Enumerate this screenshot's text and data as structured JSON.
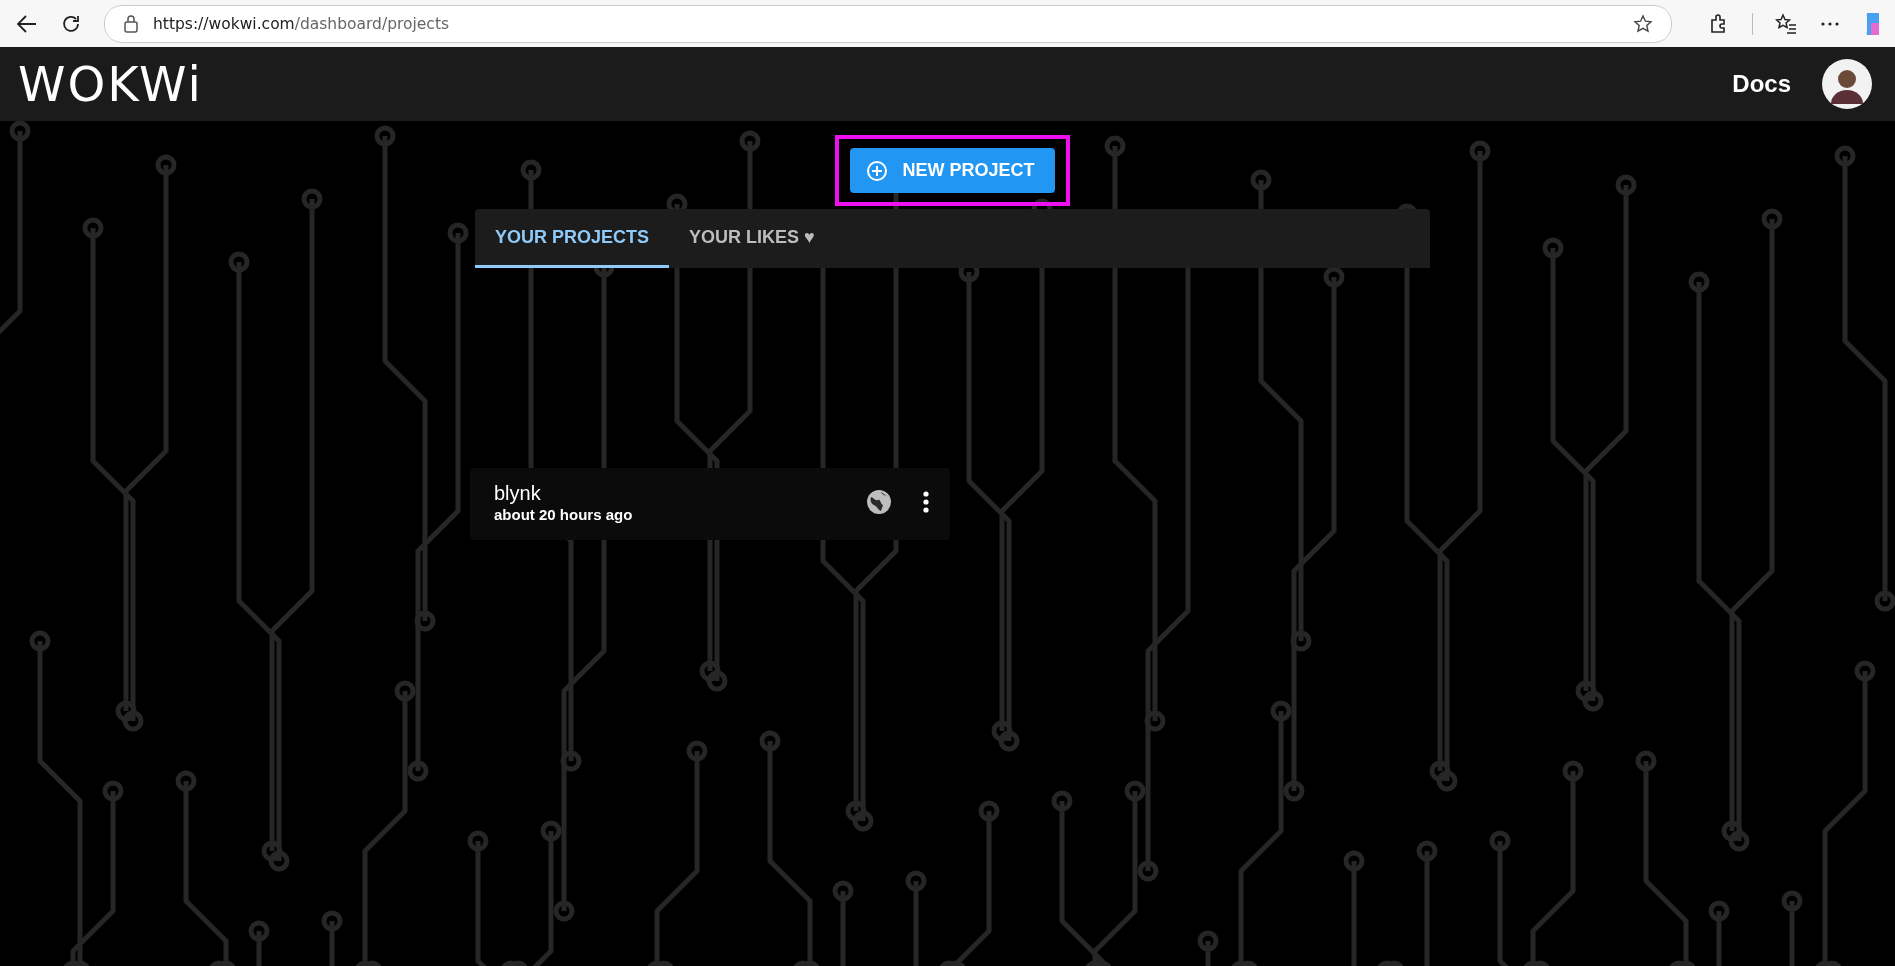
{
  "browser": {
    "url_host": "https://wokwi.com",
    "url_path": "/dashboard/projects"
  },
  "header": {
    "logo": "WOKWi",
    "nav_link": "Docs"
  },
  "new_project_button": {
    "label": "NEW PROJECT",
    "highlighted": true
  },
  "tabs": [
    {
      "label": "YOUR PROJECTS",
      "selected": true
    },
    {
      "label": "YOUR LIKES ♥",
      "selected": false
    }
  ],
  "projects": [
    {
      "name": "blynk",
      "updated": "about 20 hours ago",
      "public": true
    }
  ]
}
